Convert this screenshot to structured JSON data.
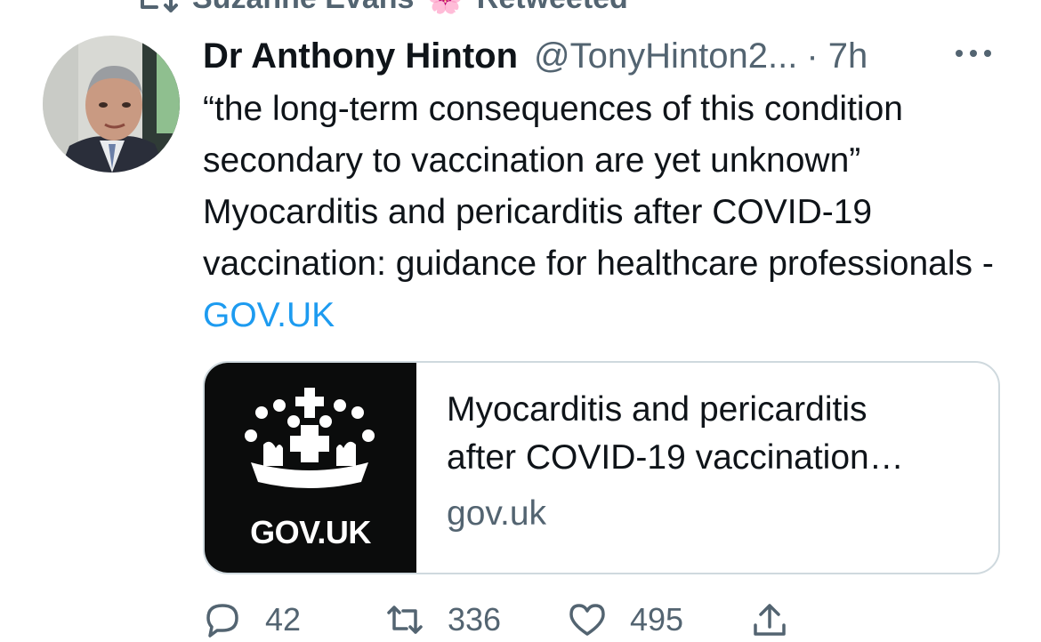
{
  "retweet_context": {
    "name": "Suzanne Evans",
    "emoji": "🌸",
    "label": "Retweeted"
  },
  "tweet": {
    "author_name": "Dr Anthony Hinton",
    "handle": "@TonyHinton2...",
    "time": "· 7h",
    "text": "“the long-term consequences of this condition secondary to vaccination are yet unknown” Myocarditis and pericarditis after COVID-19 vaccination: guidance for healthcare professionals - ",
    "link_text": "GOV.UK"
  },
  "card": {
    "thumb_label": "GOV.UK",
    "title_line1": "Myocarditis and pericarditis",
    "title_line2": "after COVID-19 vaccination…",
    "domain": "gov.uk"
  },
  "actions": {
    "replies": "42",
    "retweets": "336",
    "likes": "495"
  },
  "colors": {
    "link": "#1d9bf0",
    "muted": "#536471",
    "card_border": "#cfd9de",
    "govuk_black": "#0b0c0c"
  },
  "icons": [
    "retweet-icon",
    "more-icon",
    "crown-icon",
    "reply-icon",
    "like-icon",
    "share-icon"
  ]
}
